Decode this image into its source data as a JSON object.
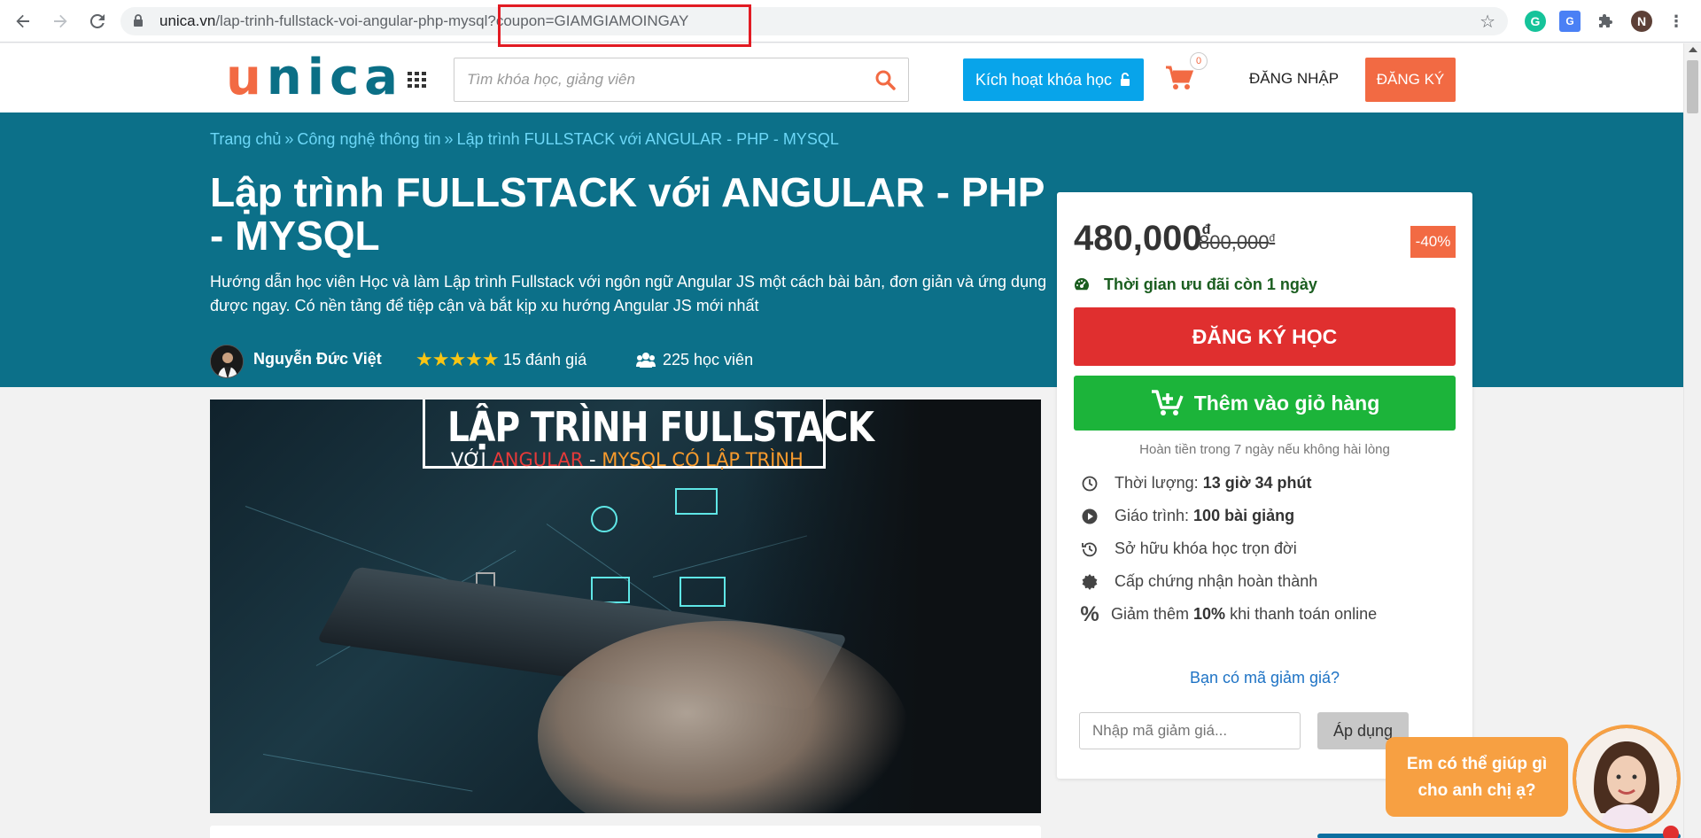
{
  "browser": {
    "url_domain": "unica.vn",
    "url_path": "/lap-trinh-fullstack-voi-angular-php-mysql",
    "url_query": "?coupon=GIAMGIAMOINGAY",
    "profile_initial": "N"
  },
  "header": {
    "logo_text": "unica",
    "search_placeholder": "Tìm khóa học, giảng viên",
    "activate_label": "Kích hoạt khóa học",
    "cart_count": "0",
    "login_label": "ĐĂNG NHẬP",
    "register_label": "ĐĂNG KÝ"
  },
  "breadcrumb": {
    "items": [
      "Trang chủ",
      "Công nghệ thông tin",
      "Lập trình FULLSTACK với ANGULAR - PHP - MYSQL"
    ],
    "separator": "»"
  },
  "course": {
    "title": "Lập trình FULLSTACK với ANGULAR - PHP - MYSQL",
    "description": "Hướng dẫn học viên Học và làm Lập trình Fullstack với ngôn ngữ Angular JS một cách bài bản, đơn giản và ứng dụng được ngay. Có nền tảng để tiệp cận và bắt kịp xu hướng Angular JS mới nhất",
    "author": "Nguyễn Đức Việt",
    "rating_stars": 5,
    "reviews": "15 đánh giá",
    "students": "225 học viên"
  },
  "banner": {
    "title": "LẬP TRÌNH FULLSTACK",
    "sub_prefix": "VỚI",
    "sub_angular": "ANGULAR",
    "sub_dash": " - ",
    "sub_rest": "MYSQL CÓ LẬP TRÌNH"
  },
  "pricing": {
    "price": "480,000",
    "currency": "đ",
    "old_price": "800,000",
    "discount": "-40%",
    "timer_text": "Thời gian ưu đãi còn 1 ngày",
    "enroll_label": "ĐĂNG KÝ HỌC",
    "add_cart_label": "Thêm vào giỏ hàng",
    "refund_text": "Hoàn tiền trong 7 ngày nếu không hài lòng",
    "features": [
      {
        "icon": "clock-icon",
        "label": "Thời lượng:",
        "value": "13 giờ 34 phút",
        "suffix": ""
      },
      {
        "icon": "play-icon",
        "label": "Giáo trình:",
        "value": "100 bài giảng",
        "suffix": ""
      },
      {
        "icon": "history-icon",
        "label": "Sở hữu khóa học trọn đời",
        "value": "",
        "suffix": ""
      },
      {
        "icon": "certificate-icon",
        "label": "Cấp chứng nhận hoàn thành",
        "value": "",
        "suffix": ""
      },
      {
        "icon": "percent-icon",
        "label": "Giảm thêm",
        "value": "10%",
        "suffix": "khi thanh toán online"
      }
    ],
    "coupon_question": "Bạn có mã giảm giá?",
    "coupon_placeholder": "Nhập mã giảm giá...",
    "apply_label": "Áp dụng"
  },
  "chat": {
    "line1": "Em có thể giúp gì",
    "line2": "cho anh chị ạ?"
  },
  "colors": {
    "hero_bg": "#0c7089",
    "accent_orange": "#f26a43",
    "enroll_red": "#e02f2f",
    "cart_green": "#1cb43a",
    "activate_blue": "#08a4ea"
  }
}
